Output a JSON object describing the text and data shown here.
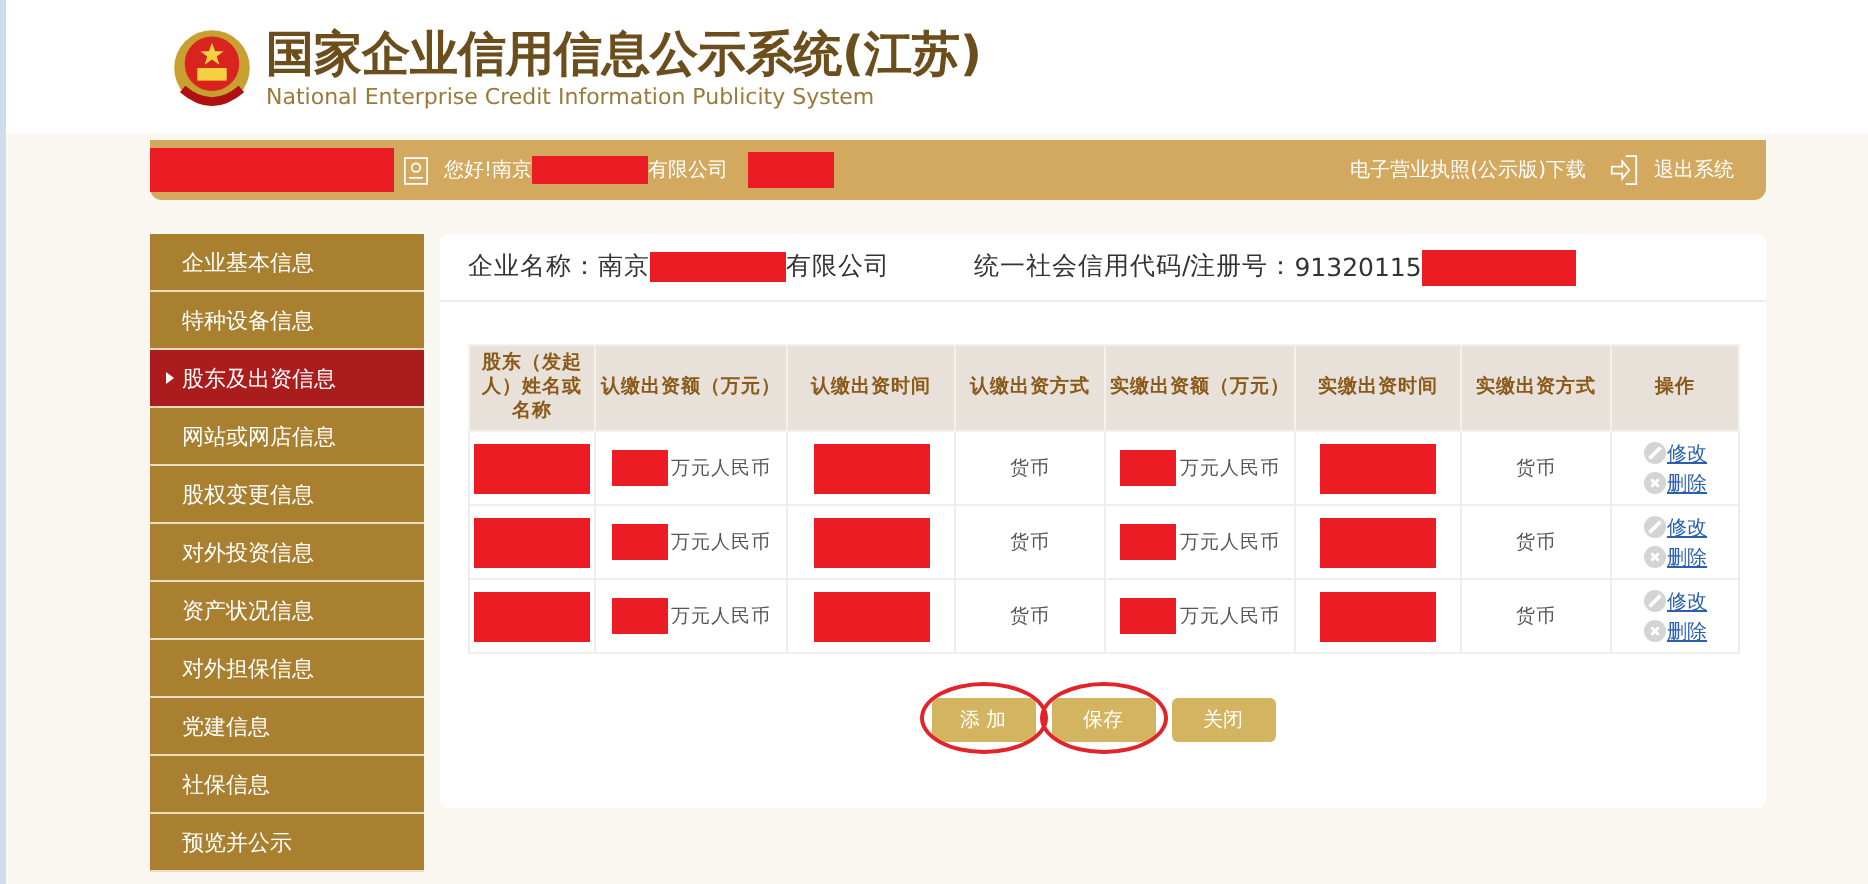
{
  "header": {
    "title": "国家企业信用信息公示系统(江苏)",
    "subtitle": "National Enterprise Credit Information Publicity System"
  },
  "top_bar": {
    "greeting_prefix": "您好!南京",
    "greeting_suffix": "有限公司",
    "links": [
      "电子营业执照(公示版)下载",
      "退出系统"
    ]
  },
  "sidebar": {
    "items": [
      {
        "label": "企业基本信息",
        "selected": false
      },
      {
        "label": "特种设备信息",
        "selected": false
      },
      {
        "label": "股东及出资信息",
        "selected": true
      },
      {
        "label": "网站或网店信息",
        "selected": false
      },
      {
        "label": "股权变更信息",
        "selected": false
      },
      {
        "label": "对外投资信息",
        "selected": false
      },
      {
        "label": "资产状况信息",
        "selected": false
      },
      {
        "label": "对外担保信息",
        "selected": false
      },
      {
        "label": "党建信息",
        "selected": false
      },
      {
        "label": "社保信息",
        "selected": false
      },
      {
        "label": "预览并公示",
        "selected": false
      }
    ]
  },
  "company": {
    "name_label": "企业名称：",
    "name_prefix": "南京",
    "name_suffix": "有限公司",
    "code_label": "统一社会信用代码/注册号：",
    "code_prefix": "91320115"
  },
  "table": {
    "columns": [
      "股东（发起人）姓名或名称",
      "认缴出资额（万元）",
      "认缴出资时间",
      "认缴出资方式",
      "实缴出资额（万元）",
      "实缴出资时间",
      "实缴出资方式",
      "操作"
    ],
    "rows": [
      {
        "cells": [
          {
            "redacted": true
          },
          {
            "redacted": true,
            "text": "万元人民币"
          },
          {
            "redacted": true
          },
          {
            "redacted": false,
            "text": "货币"
          },
          {
            "redacted": true,
            "text": "万元人民币"
          },
          {
            "redacted": true
          },
          {
            "redacted": false,
            "text": "货币"
          }
        ],
        "actions": [
          "修改",
          "删除"
        ]
      },
      {
        "cells": [
          {
            "redacted": true
          },
          {
            "redacted": true,
            "text": "万元人民币"
          },
          {
            "redacted": true
          },
          {
            "redacted": false,
            "text": "货币"
          },
          {
            "redacted": true,
            "text": "万元人民币"
          },
          {
            "redacted": true
          },
          {
            "redacted": false,
            "text": "货币"
          }
        ],
        "actions": [
          "修改",
          "删除"
        ]
      },
      {
        "cells": [
          {
            "redacted": true
          },
          {
            "redacted": true,
            "text": "万元人民币"
          },
          {
            "redacted": true
          },
          {
            "redacted": false,
            "text": "货币"
          },
          {
            "redacted": true,
            "text": "万元人民币"
          },
          {
            "redacted": true
          },
          {
            "redacted": false,
            "text": "货币"
          }
        ],
        "actions": [
          "修改",
          "删除"
        ]
      }
    ]
  },
  "buttons": [
    {
      "label": "添 加",
      "circled": true
    },
    {
      "label": "保存",
      "circled": true
    },
    {
      "label": "关闭",
      "circled": false
    }
  ]
}
